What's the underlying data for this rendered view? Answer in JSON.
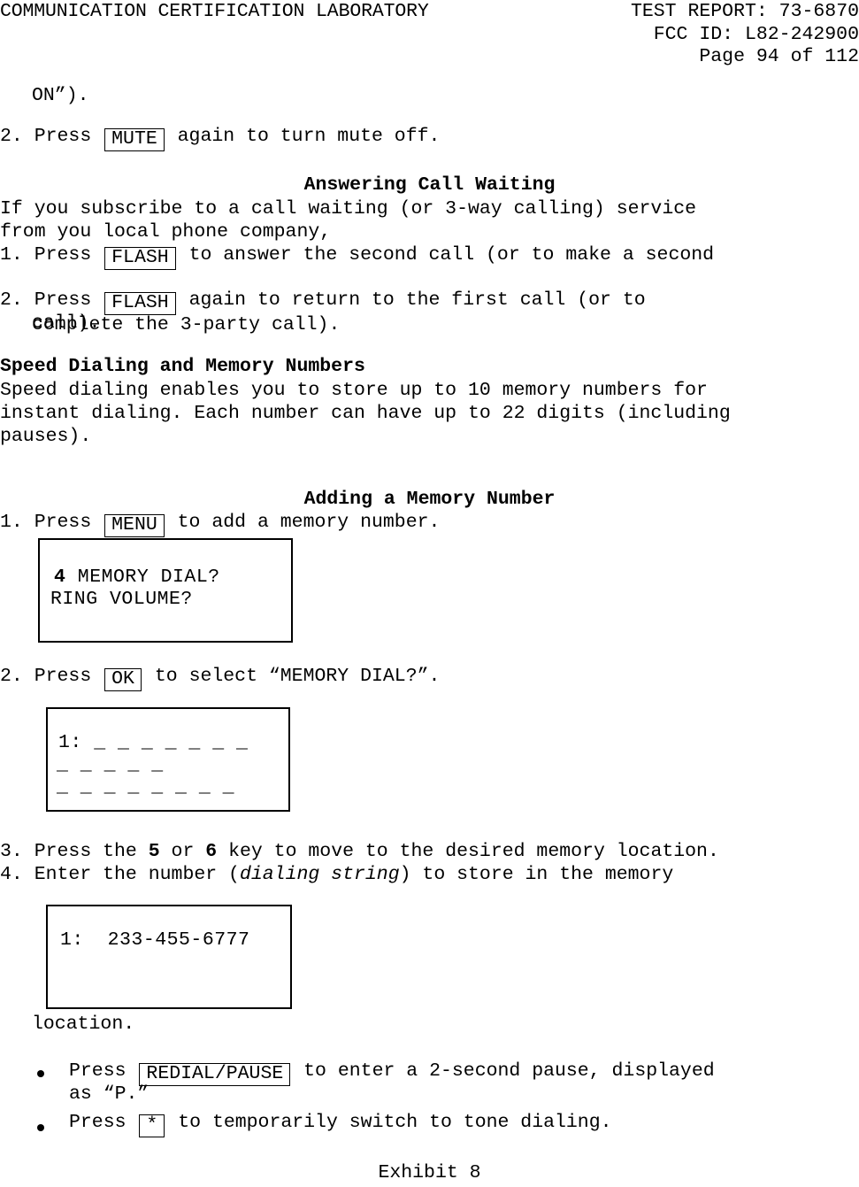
{
  "header": {
    "lab_name": "COMMUNICATION CERTIFICATION LABORATORY",
    "test_report": "TEST REPORT: 73-6870",
    "fcc_id": "FCC ID: L82-242900",
    "page_number": "Page 94 of 112"
  },
  "body": {
    "continuation_line": "ON”).",
    "step_mute": {
      "number": "2.",
      "press": "Press",
      "key": "MUTE",
      "rest": "again to turn mute off."
    },
    "call_waiting": {
      "heading": "Answering Call Waiting",
      "intro_line1": "If you subscribe to a call waiting (or 3-way calling) service",
      "intro_line2": "from you local phone company,",
      "step1": {
        "number": "1.",
        "press": "Press",
        "key": "FLASH",
        "rest": "to answer the second call (or to make a second",
        "cont": "call)."
      },
      "step2": {
        "number": "2.",
        "press": "Press",
        "key": "FLASH",
        "rest": "again to return to the first call (or to",
        "cont": "complete the 3-party call)."
      }
    },
    "speed_dialing": {
      "heading": "Speed Dialing and Memory Numbers",
      "para_line1": "Speed dialing enables you to store up to 10 memory numbers for",
      "para_line2": "instant dialing. Each number can have up to 22 digits (including",
      "para_line3": "pauses)."
    },
    "adding_memory": {
      "heading": "Adding a Memory Number",
      "step1": {
        "number": "1.",
        "press": "Press",
        "key": "MENU",
        "rest": "to add a memory number."
      },
      "lcd1": {
        "line1_bold": "4",
        "line1_rest": " MEMORY DIAL?",
        "line2": "RING VOLUME?"
      },
      "step2": {
        "number": "2.",
        "press": "Press",
        "key": "OK",
        "rest": "to select “MEMORY DIAL?”."
      },
      "lcd2": {
        "line1": "1: _ _ _ _ _ _ _",
        "line2": "_ _ _ _ _",
        "line3": "_ _ _ _ _ _ _ _"
      },
      "step3": {
        "number": "3.",
        "text_a": "Press the ",
        "key_a": "5",
        "text_b": " or ",
        "key_b": "6",
        "text_c": " key to move to the desired memory location."
      },
      "step4": {
        "number": "4.",
        "text_a": "Enter the number (",
        "italic": "dialing string",
        "text_b": ") to store in the memory"
      },
      "lcd3": {
        "line1": "1:  233-455-6777"
      },
      "step4_cont": "location."
    },
    "bullets": [
      {
        "press": "Press",
        "key": "REDIAL/PAUSE",
        "rest": "to enter a 2-second pause, displayed",
        "cont": "as “P.”"
      },
      {
        "press": "Press",
        "key": "*",
        "rest": "to temporarily switch to tone dialing.",
        "cont": ""
      }
    ]
  },
  "footer": {
    "exhibit": "Exhibit 8"
  }
}
